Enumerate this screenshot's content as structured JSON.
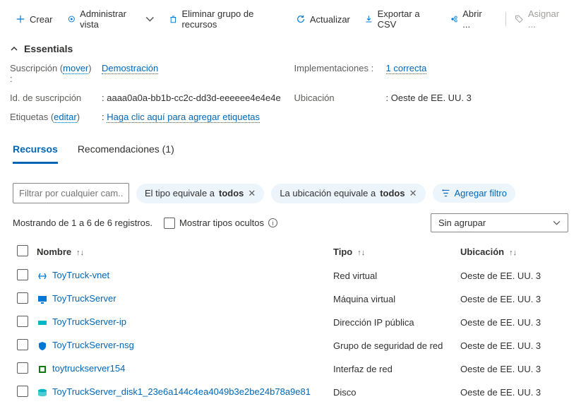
{
  "toolbar": {
    "create": "Crear",
    "manageView": "Administrar vista",
    "deleteGroup": "Eliminar grupo de recursos",
    "refresh": "Actualizar",
    "export": "Exportar a CSV",
    "open": "Abrir ...",
    "assign": "Asignar ..."
  },
  "essentials": {
    "title": "Essentials",
    "subscriptionLabel": "Suscripción (",
    "moveLink": "mover",
    "subscriptionLabelEnd": ")  :",
    "subscriptionValue": "Demostración",
    "subIdLabel": "Id. de suscripción",
    "subIdValue": "aaaa0a0a-bb1b-cc2c-dd3d-eeeeee4e4e4e",
    "tagsLabel": "Etiquetas (",
    "editLink": "editar",
    "tagsLabelEnd": ")",
    "tagsValue": "Haga clic aquí para agregar etiquetas",
    "deploymentsLabel": "Implementaciones  :",
    "deploymentsValue": "1 correcta",
    "locationLabel": "Ubicación",
    "locationValue": "Oeste de EE. UU. 3"
  },
  "tabs": {
    "resources": "Recursos",
    "recommendations": "Recomendaciones (1)"
  },
  "filters": {
    "searchPlaceholder": "Filtrar por cualquier cam...",
    "typePillPre": "El tipo equivale a ",
    "typePillBold": "todos",
    "locPillPre": "La ubicación equivale a ",
    "locPillBold": "todos",
    "addFilter": "Agregar filtro"
  },
  "meta": {
    "showing": "Mostrando de 1 a 6 de 6 registros.",
    "showHidden": "Mostrar tipos ocultos",
    "groupBy": "Sin agrupar"
  },
  "columns": {
    "name": "Nombre",
    "type": "Tipo",
    "location": "Ubicación"
  },
  "rows": [
    {
      "name": "ToyTruck-vnet",
      "type": "Red virtual",
      "location": "Oeste de EE. UU. 3",
      "iconColor": "#0078d4",
      "iconKind": "vnet"
    },
    {
      "name": "ToyTruckServer",
      "type": "Máquina virtual",
      "location": "Oeste de EE. UU. 3",
      "iconColor": "#0078d4",
      "iconKind": "vm"
    },
    {
      "name": "ToyTruckServer-ip",
      "type": "Dirección IP pública",
      "location": "Oeste de EE. UU. 3",
      "iconColor": "#00b7c3",
      "iconKind": "ip"
    },
    {
      "name": "ToyTruckServer-nsg",
      "type": "Grupo de seguridad de red",
      "location": "Oeste de EE. UU. 3",
      "iconColor": "#0078d4",
      "iconKind": "shield"
    },
    {
      "name": "toytruckserver154",
      "type": "Interfaz de red",
      "location": "Oeste de EE. UU. 3",
      "iconColor": "#107c10",
      "iconKind": "nic"
    },
    {
      "name": "ToyTruckServer_disk1_23e6a144c4ea4049b3e2be24b78a9e81",
      "type": "Disco",
      "location": "Oeste de EE. UU. 3",
      "iconColor": "#00b7c3",
      "iconKind": "disk"
    }
  ]
}
